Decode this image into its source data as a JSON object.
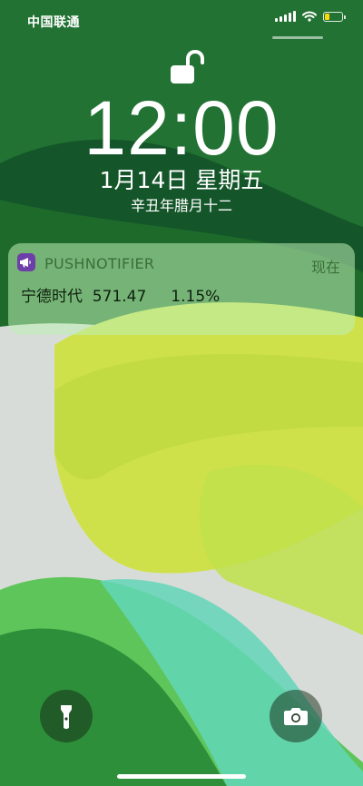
{
  "status_bar": {
    "carrier": "中国联通",
    "battery_level": 0.3,
    "battery_color": "#ffd60a"
  },
  "lock_screen": {
    "lock_state": "unlocked",
    "time": "12:00",
    "date": "1月14日 星期五",
    "lunar_date": "辛丑年腊月十二"
  },
  "notification": {
    "app_name": "PUSHNOTIFIER",
    "time": "现在",
    "body": "宁德时代  571.47     1.15%",
    "app_icon_color": "#6d3fa8",
    "icon": "megaphone-icon"
  },
  "quick_actions": {
    "left_icon": "flashlight-icon",
    "right_icon": "camera-icon"
  }
}
